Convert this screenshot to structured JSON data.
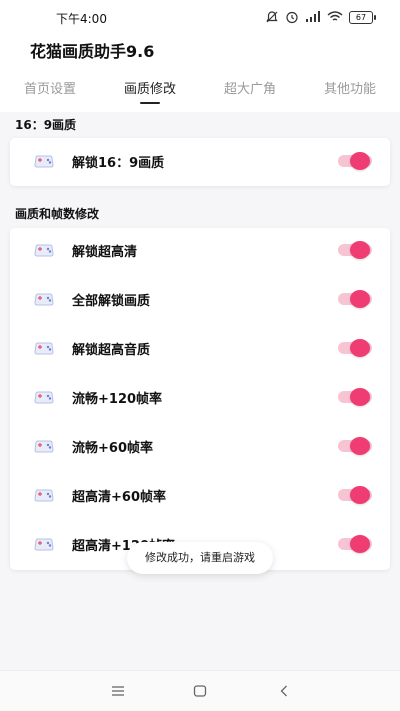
{
  "status_bar": {
    "time": "下午4:00",
    "battery_level": "67",
    "icons": [
      "notifications-off-icon",
      "alarm-icon",
      "signal-icon",
      "wifi-icon",
      "battery-icon"
    ]
  },
  "app": {
    "title": "花猫画质助手9.6"
  },
  "tabs": [
    {
      "label": "首页设置",
      "active": false
    },
    {
      "label": "画质修改",
      "active": true
    },
    {
      "label": "超大广角",
      "active": false
    },
    {
      "label": "其他功能",
      "active": false
    }
  ],
  "sections": [
    {
      "title": "16：9画质",
      "items": [
        {
          "label": "解锁16：9画质",
          "enabled": true
        }
      ]
    },
    {
      "title": "画质和帧数修改",
      "items": [
        {
          "label": "解锁超高清",
          "enabled": true
        },
        {
          "label": "全部解锁画质",
          "enabled": true
        },
        {
          "label": "解锁超高音质",
          "enabled": true
        },
        {
          "label": "流畅+120帧率",
          "enabled": true
        },
        {
          "label": "流畅+60帧率",
          "enabled": true
        },
        {
          "label": "超高清+60帧率",
          "enabled": true
        },
        {
          "label": "超高清+120帧率",
          "enabled": true
        }
      ]
    }
  ],
  "toast": {
    "message": "修改成功，请重启游戏"
  },
  "nav_bar": {
    "buttons": [
      "menu-icon",
      "home-icon",
      "back-icon"
    ]
  },
  "colors": {
    "accent": "#ef3d73",
    "accent_track": "#f7c4d3",
    "tab_inactive": "#9a9a9a",
    "background": "#f6f6f8"
  }
}
